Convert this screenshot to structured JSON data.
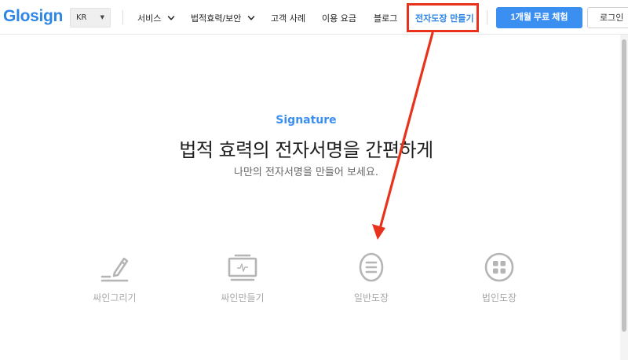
{
  "header": {
    "logo": "Glosign",
    "language": "KR",
    "nav": [
      {
        "label": "서비스",
        "has_dropdown": true
      },
      {
        "label": "법적효력/보안",
        "has_dropdown": true
      },
      {
        "label": "고객 사례",
        "has_dropdown": false
      },
      {
        "label": "이용 요금",
        "has_dropdown": false
      },
      {
        "label": "블로그",
        "has_dropdown": false
      },
      {
        "label": "전자도장 만들기",
        "has_dropdown": false,
        "active": true
      }
    ],
    "trial_button": "1개월 무료 체험",
    "login_button": "로그인"
  },
  "hero": {
    "eyebrow": "Signature",
    "title": "법적 효력의 전자서명을 간편하게",
    "subtitle": "나만의 전자서명을 만들어 보세요."
  },
  "features": [
    {
      "label": "싸인그리기",
      "icon": "pen-draw-icon"
    },
    {
      "label": "싸인만들기",
      "icon": "signature-board-icon"
    },
    {
      "label": "일반도장",
      "icon": "oval-stamp-icon"
    },
    {
      "label": "법인도장",
      "icon": "round-seal-icon"
    }
  ],
  "colors": {
    "brand": "#2d86e5",
    "primary_button": "#3b8ff0",
    "annotation": "#e8321c",
    "icon_gray": "#b5b5b5"
  }
}
